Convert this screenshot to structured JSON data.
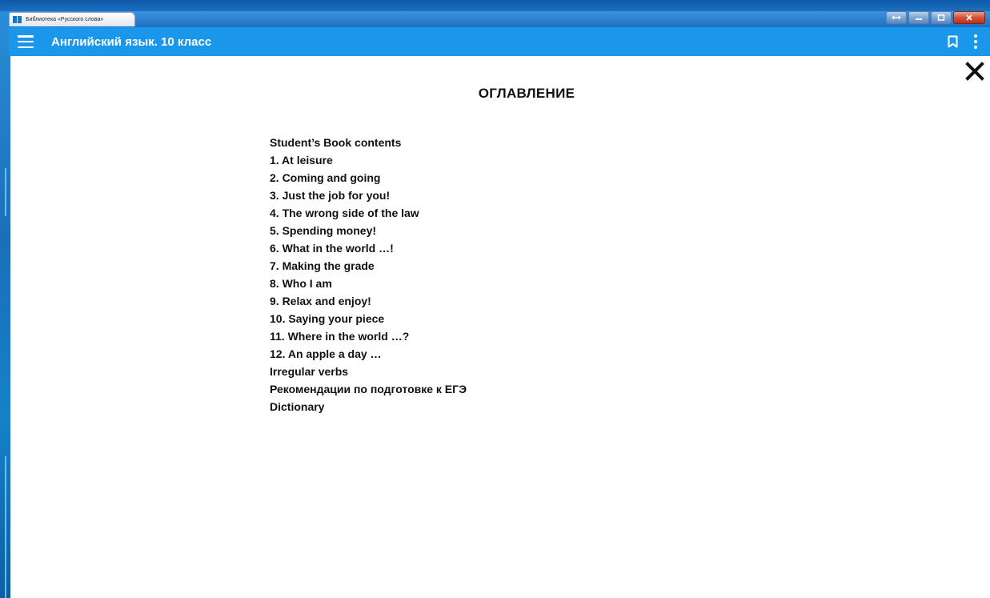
{
  "window": {
    "tab_title": "Библиотека «Русского слова»"
  },
  "appbar": {
    "title": "Английский язык. 10 класс",
    "icons": {
      "menu": "hamburger-menu-icon",
      "bookmark": "bookmark-icon",
      "more": "more-vert-icon",
      "close": "close-icon"
    }
  },
  "toc": {
    "heading": "ОГЛАВЛЕНИЕ",
    "items": [
      "Student’s Book contents",
      "1. At leisure",
      "2. Coming and going",
      "3. Just the job for you!",
      "4. The wrong side of the law",
      "5. Spending money!",
      "6. What in the world …!",
      "7. Making the grade",
      "8. Who I am",
      "9. Relax and enjoy!",
      "10. Saying your piece",
      "11. Where in the world …?",
      "12. An apple a day …",
      "Irregular verbs",
      "Рекомендации по подготовке к ЕГЭ",
      "Dictionary"
    ]
  },
  "colors": {
    "appbar": "#1a97ea",
    "text": "#111111",
    "background": "#ffffff"
  }
}
